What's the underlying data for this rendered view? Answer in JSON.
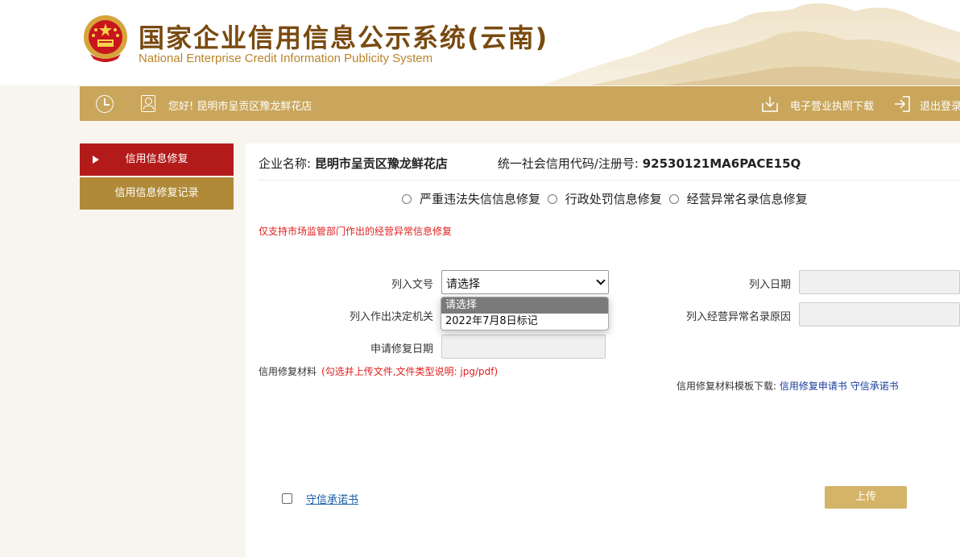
{
  "header": {
    "title_cn": "国家企业信用信息公示系统(云南)",
    "title_en": "National Enterprise Credit Information Publicity System",
    "emblem_icon": "national-emblem-icon",
    "accent_color": "#7a4a10"
  },
  "topbar": {
    "greeting": "您好! 昆明市呈贡区豫龙鲜花店",
    "license_download": "电子营业执照下载",
    "logout": "退出登录",
    "bar_color": "#c9a65b"
  },
  "sidebar": {
    "items": [
      {
        "label": "信用信息修复",
        "active": true
      },
      {
        "label": "信用信息修复记录",
        "active": false
      }
    ]
  },
  "main": {
    "company_label": "企业名称: ",
    "company_name": "昆明市呈贡区豫龙鲜花店",
    "code_label": "统一社会信用代码/注册号: ",
    "code_value": "92530121MA6PACE15Q",
    "radio_options": [
      "严重违法失信信息修复",
      "行政处罚信息修复",
      "经营异常名录信息修复"
    ],
    "notice": "仅支持市场监管部门作出的经营异常信息修复",
    "fields": {
      "doc_number_label": "列入文号",
      "doc_number_value": "请选择",
      "doc_number_options": [
        "请选择",
        "2022年7月8日标记"
      ],
      "date_label": "列入日期",
      "authority_label": "列入作出决定机关",
      "reason_label": "列入经营异常名录原因",
      "apply_date_label": "申请修复日期"
    },
    "materials_label": "信用修复材料",
    "materials_note": "(勾选并上传文件,文件类型说明: jpg/pdf)",
    "template_label": "信用修复材料模板下载: ",
    "template_links": [
      "信用修复申请书",
      "守信承诺书"
    ],
    "pledge_label": "守信承诺书",
    "upload_label": "上传"
  }
}
